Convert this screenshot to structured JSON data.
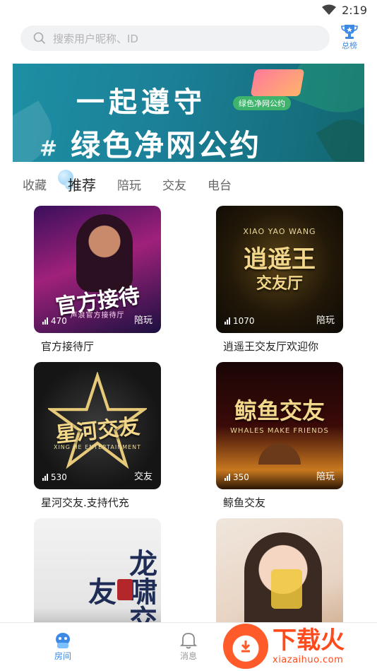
{
  "status_bar": {
    "time": "2:19"
  },
  "search": {
    "placeholder": "搜索用户昵称、ID"
  },
  "rank": {
    "label": "总榜"
  },
  "banner": {
    "line1": "一起遵守",
    "line2": "绿色净网公约",
    "hash": "#",
    "badge": "绿色净网公约"
  },
  "tabs": [
    {
      "label": "收藏",
      "active": false
    },
    {
      "label": "推荐",
      "active": true
    },
    {
      "label": "陪玩",
      "active": false
    },
    {
      "label": "交友",
      "active": false
    },
    {
      "label": "电台",
      "active": false
    }
  ],
  "rooms": [
    {
      "name": "官方接待厅",
      "count": "470",
      "tag": "陪玩",
      "cover_title": "官方接待",
      "cover_sub": "声浪官方接待厅",
      "theme": "purple"
    },
    {
      "name": "逍遥王交友厅欢迎你",
      "count": "1070",
      "tag": "陪玩",
      "cover_title": "逍遥王",
      "cover_title2": "交友厅",
      "cover_sub": "XIAO YAO WANG",
      "theme": "gold"
    },
    {
      "name": "星河交友.支持代充",
      "count": "530",
      "tag": "交友",
      "cover_title": "星河交友",
      "cover_sub": "XING HE ENTERTAINMENT",
      "theme": "star"
    },
    {
      "name": "鲸鱼交友",
      "count": "350",
      "tag": "陪玩",
      "cover_title": "鲸鱼交友",
      "cover_sub": "WHALES MAKE FRIENDS",
      "theme": "whale"
    },
    {
      "name": "",
      "count": "",
      "tag": "",
      "cover_title": "龙啸交友",
      "cover_sub": "",
      "theme": "ink"
    },
    {
      "name": "",
      "count": "",
      "tag": "",
      "cover_title": "",
      "cover_sub": "",
      "theme": "photo"
    }
  ],
  "bottom_nav": [
    {
      "label": "房间",
      "icon": "room-icon",
      "active": true
    },
    {
      "label": "消息",
      "icon": "bell-icon",
      "active": false
    }
  ],
  "watermark": {
    "main": "下载火",
    "url": "xiazaihuo.com"
  },
  "colors": {
    "accent": "#3d8ae6",
    "watermark": "#ff4a1c"
  }
}
